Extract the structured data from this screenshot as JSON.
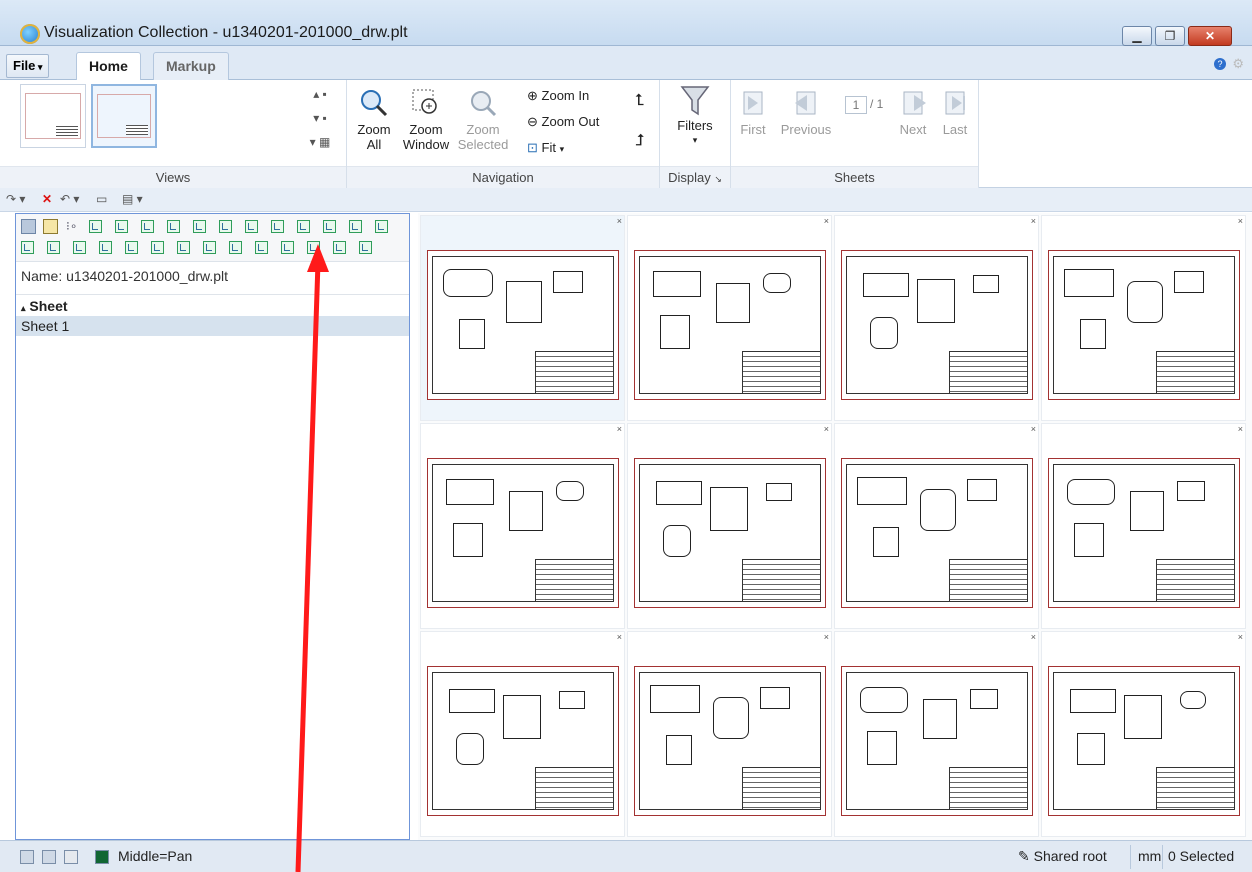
{
  "window": {
    "title": "Visualization Collection - u1340201-201000_drw.plt",
    "min": "▁",
    "max": "❐",
    "close": "✕"
  },
  "tabs": {
    "file": "File",
    "home": "Home",
    "markup": "Markup"
  },
  "ribbon": {
    "views_label": "Views",
    "navigation_label": "Navigation",
    "display_label": "Display",
    "sheets_label": "Sheets",
    "zoom_all": [
      "Zoom",
      "All"
    ],
    "zoom_window": [
      "Zoom",
      "Window"
    ],
    "zoom_selected": [
      "Zoom",
      "Selected"
    ],
    "zoom_in": "Zoom In",
    "zoom_out": "Zoom Out",
    "fit": "Fit",
    "filters": "Filters",
    "first": "First",
    "previous": "Previous",
    "next": "Next",
    "last": "Last",
    "page_current": "1",
    "page_total": "/ 1"
  },
  "leftpanel": {
    "name": "Name: u1340201-201000_drw.plt",
    "sheet_header": "Sheet",
    "sheet_row": "Sheet 1"
  },
  "status": {
    "mouse_mode": "Middle=Pan",
    "shared_root": "Shared root",
    "units": "mm",
    "selected": "0 Selected"
  },
  "colors": {
    "accent": "#6f95d9",
    "sheet_border": "#a33232",
    "arrow": "#ff1a1a"
  }
}
